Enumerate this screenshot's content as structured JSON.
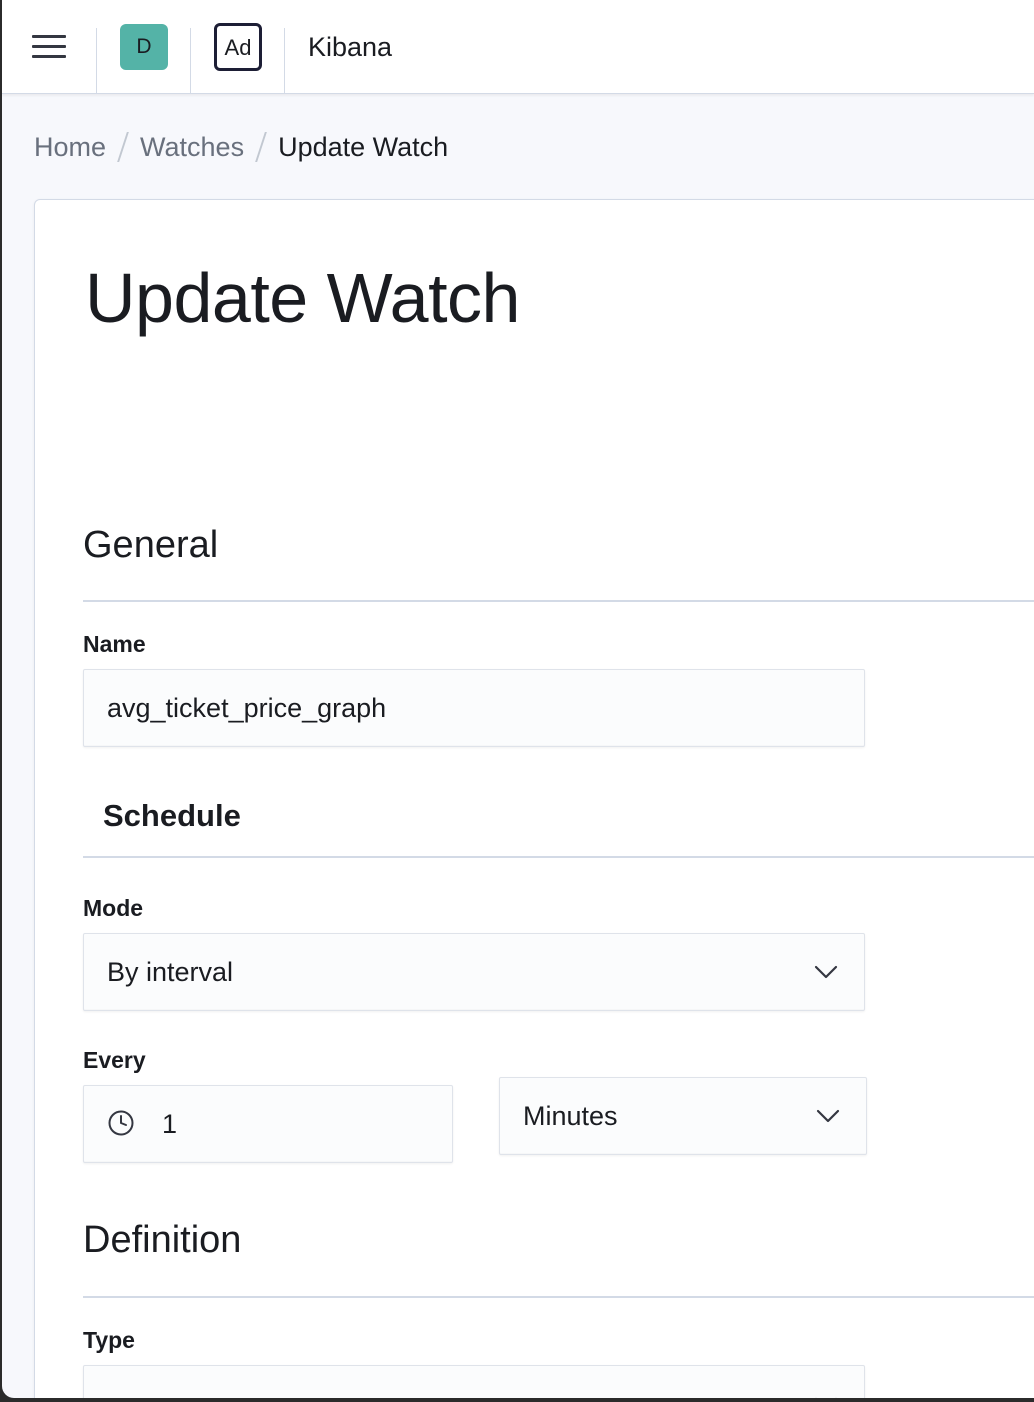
{
  "header": {
    "menu_icon": "hamburger-menu-icon",
    "space_avatar": "D",
    "app_avatar": "Ad",
    "brand": "Kibana"
  },
  "breadcrumbs": [
    "Home",
    "Watches",
    "Update Watch"
  ],
  "page": {
    "title": "Update Watch"
  },
  "general": {
    "title": "General",
    "name_label": "Name",
    "name_value": "avg_ticket_price_graph",
    "schedule_title": "Schedule",
    "mode_label": "Mode",
    "mode_value": "By interval",
    "every_label": "Every",
    "every_value": "1",
    "unit_value": "Minutes"
  },
  "definition": {
    "title": "Definition",
    "type_label": "Type"
  },
  "colors": {
    "space_avatar_bg": "#54b3a7",
    "app_avatar_border": "#1d1e35",
    "text": "#1a1c21",
    "muted": "#69707d"
  }
}
